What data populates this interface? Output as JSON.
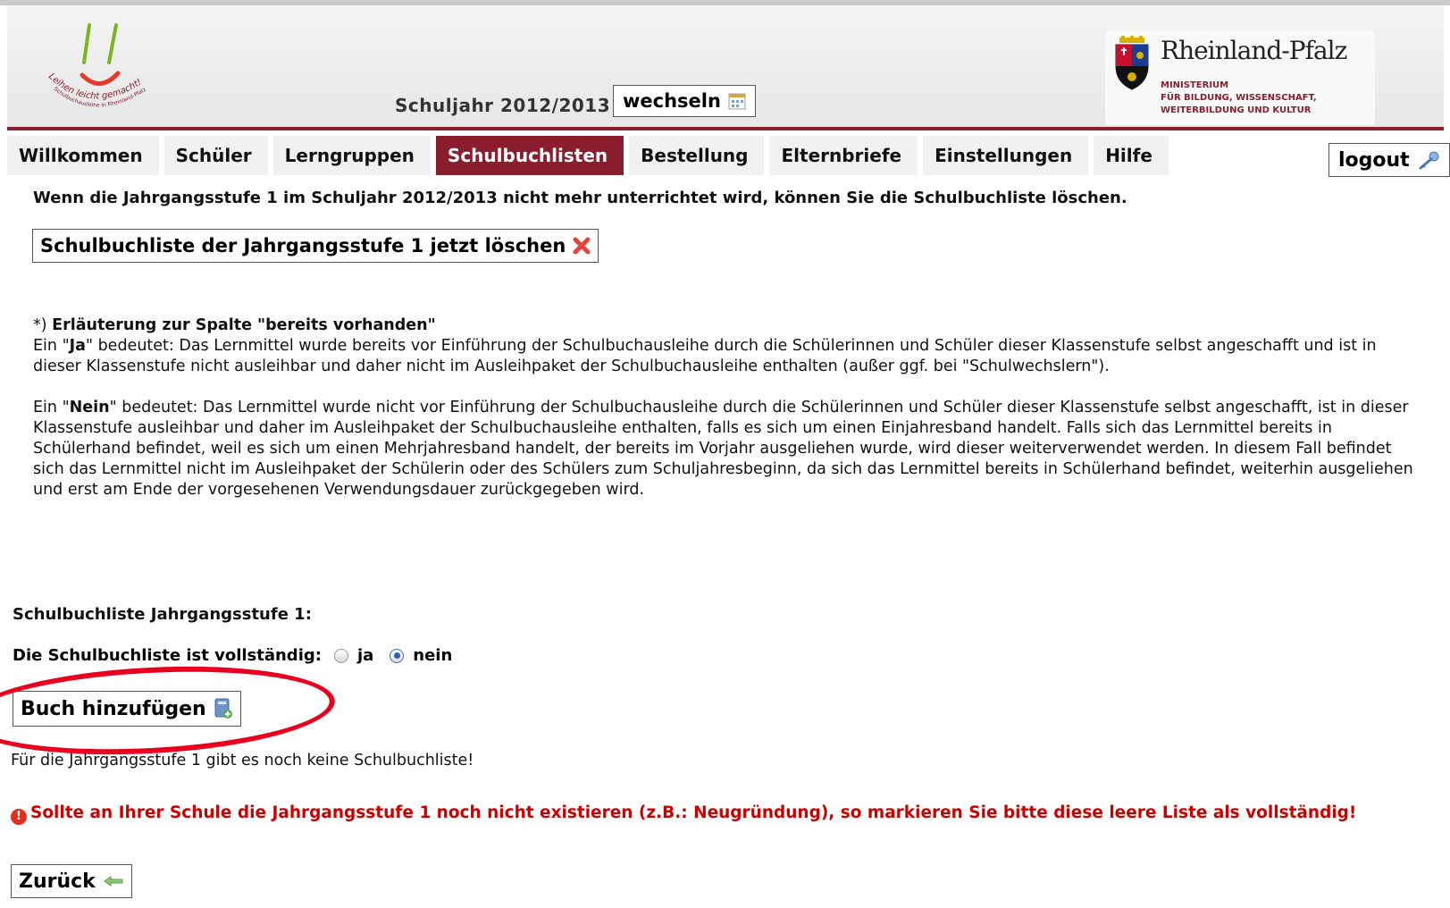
{
  "header": {
    "logo_text": "Leihen leicht gemacht! Schulbuchausleihe in Rheinland-Pfalz",
    "school_year_label": "Schuljahr 2012/2013",
    "change_button": "wechseln",
    "ministry": {
      "state_name": "Rheinland-Pfalz",
      "line1": "MINISTERIUM",
      "line2": "FÜR BILDUNG, WISSENSCHAFT,",
      "line3": "WEITERBILDUNG UND KULTUR"
    }
  },
  "nav": {
    "tabs": [
      {
        "label": "Willkommen"
      },
      {
        "label": "Schüler"
      },
      {
        "label": "Lerngruppen"
      },
      {
        "label": "Schulbuchlisten"
      },
      {
        "label": "Bestellung"
      },
      {
        "label": "Elternbriefe"
      },
      {
        "label": "Einstellungen"
      },
      {
        "label": "Hilfe"
      }
    ],
    "active_tab": "Schulbuchlisten",
    "logout": "logout"
  },
  "main": {
    "info": "Wenn die Jahrgangsstufe 1 im Schuljahr 2012/2013 nicht mehr unterrichtet wird, können Sie die Schulbuchliste löschen.",
    "delete_button": "Schulbuchliste der Jahrgangsstufe 1 jetzt löschen",
    "note": {
      "marker": "*)",
      "title": "Erläuterung zur Spalte \"bereits vorhanden\"",
      "ja_prefix": "Ein \"",
      "ja_word": "Ja",
      "ja_text": "\" bedeutet: Das Lernmittel wurde bereits vor Einführung der Schulbuchausleihe durch die Schülerinnen und Schüler dieser Klassenstufe selbst angeschafft und ist in dieser Klassenstufe nicht ausleihbar und daher nicht im Ausleihpaket der Schulbuchausleihe enthalten (außer ggf. bei \"Schulwechslern\").",
      "nein_prefix": "Ein \"",
      "nein_word": "Nein",
      "nein_text": "\" bedeutet: Das Lernmittel wurde nicht vor Einführung der Schulbuchausleihe durch die Schülerinnen und Schüler dieser Klassenstufe selbst angeschafft, ist in dieser Klassenstufe ausleihbar und daher im Ausleihpaket der Schulbuchausleihe enthalten, falls es sich um einen Einjahresband handelt. Falls sich das Lernmittel bereits in Schülerhand befindet, weil es sich um einen Mehrjahresband handelt, der bereits im Vorjahr ausgeliehen wurde, wird dieser weiterverwendet werden. In diesem Fall befindet sich das Lernmittel nicht im Ausleihpaket der Schülerin oder des Schülers zum Schuljahresbeginn, da sich das Lernmittel bereits in Schülerhand befindet, weiterhin ausgeliehen und erst am Ende der vorgesehenen Verwendungsdauer zurückgegeben wird."
    },
    "section_title": "Schulbuchliste Jahrgangsstufe 1:",
    "complete_label": "Die Schulbuchliste ist vollständig:",
    "option_yes": "ja",
    "option_no": "nein",
    "complete_value": "nein",
    "add_button": "Buch hinzufügen",
    "empty_message": "Für die Jahrgangsstufe 1 gibt es noch keine Schulbuchliste!",
    "warning": "Sollte an Ihrer Schule die Jahrgangsstufe 1 noch nicht existieren (z.B.: Neugründung), so markieren Sie bitte diese leere Liste als vollständig!",
    "back_button": "Zurück"
  },
  "colors": {
    "brand": "#8a1e2e",
    "warning": "#cc0000",
    "annotation": "#e8001e"
  }
}
